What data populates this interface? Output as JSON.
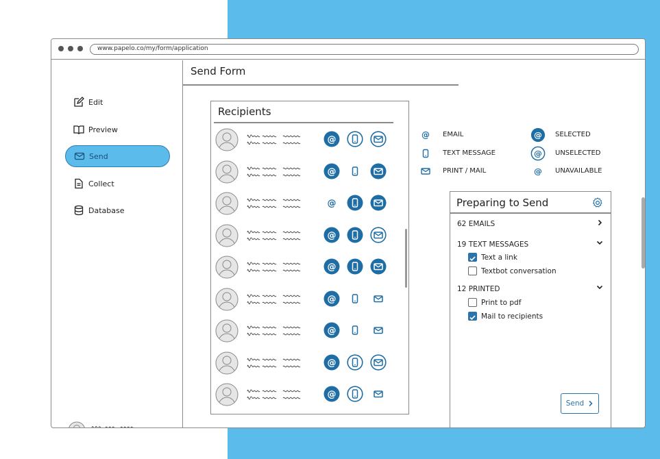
{
  "browser": {
    "url": "www.papelo.co/my/form/application"
  },
  "sidebar": {
    "items": [
      {
        "label": "Edit",
        "icon": "edit-icon"
      },
      {
        "label": "Preview",
        "icon": "book-icon"
      },
      {
        "label": "Send",
        "icon": "envelope-icon",
        "active": true
      },
      {
        "label": "Collect",
        "icon": "document-icon"
      },
      {
        "label": "Database",
        "icon": "database-icon"
      }
    ]
  },
  "page": {
    "title": "Send Form"
  },
  "recipients": {
    "title": "Recipients",
    "rows": [
      {
        "email": "selected",
        "sms": "unselected",
        "mail": "unselected"
      },
      {
        "email": "selected",
        "sms": "unavailable",
        "mail": "selected"
      },
      {
        "email": "unavailable",
        "sms": "selected",
        "mail": "selected"
      },
      {
        "email": "selected",
        "sms": "selected",
        "mail": "unselected"
      },
      {
        "email": "selected",
        "sms": "selected",
        "mail": "selected"
      },
      {
        "email": "selected",
        "sms": "unavailable",
        "mail": "unavailable"
      },
      {
        "email": "selected",
        "sms": "unavailable",
        "mail": "unavailable"
      },
      {
        "email": "selected",
        "sms": "unselected",
        "mail": "unselected"
      },
      {
        "email": "selected",
        "sms": "unselected",
        "mail": "unavailable"
      }
    ]
  },
  "legend": {
    "email": "EMAIL",
    "text_message": "TEXT MESSAGE",
    "print_mail": "PRINT / MAIL",
    "selected": "SELECTED",
    "unselected": "UNSELECTED",
    "unavailable": "UNAVAILABLE"
  },
  "preparing": {
    "title": "Preparing to Send",
    "emails": "62 EMAILS",
    "texts": "19 TEXT MESSAGES",
    "text_options": [
      {
        "label": "Text a link",
        "checked": true
      },
      {
        "label": "Textbot conversation",
        "checked": false
      }
    ],
    "printed": "12 PRINTED",
    "print_options": [
      {
        "label": "Print to pdf",
        "checked": false
      },
      {
        "label": "Mail to recipients",
        "checked": true
      }
    ],
    "send_label": "Send"
  },
  "colors": {
    "accent": "#2b73ab",
    "background": "#5bbcec"
  }
}
